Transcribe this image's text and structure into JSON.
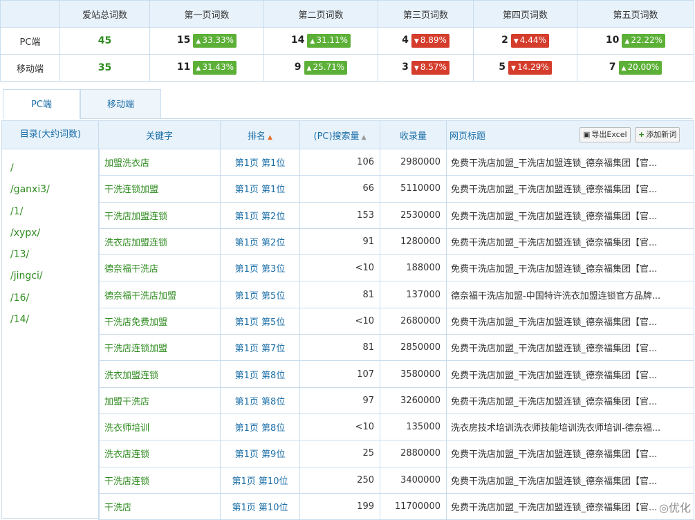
{
  "summary": {
    "headers": [
      "",
      "爱站总词数",
      "第一页词数",
      "第二页词数",
      "第三页词数",
      "第四页词数",
      "第五页词数"
    ],
    "rows": [
      {
        "label": "PC端",
        "total": "45",
        "cells": [
          {
            "num": "15",
            "pct": "33.33%",
            "dir": "up"
          },
          {
            "num": "14",
            "pct": "31.11%",
            "dir": "up"
          },
          {
            "num": "4",
            "pct": "8.89%",
            "dir": "down"
          },
          {
            "num": "2",
            "pct": "4.44%",
            "dir": "down"
          },
          {
            "num": "10",
            "pct": "22.22%",
            "dir": "up"
          }
        ]
      },
      {
        "label": "移动端",
        "total": "35",
        "cells": [
          {
            "num": "11",
            "pct": "31.43%",
            "dir": "up"
          },
          {
            "num": "9",
            "pct": "25.71%",
            "dir": "up"
          },
          {
            "num": "3",
            "pct": "8.57%",
            "dir": "down"
          },
          {
            "num": "5",
            "pct": "14.29%",
            "dir": "down"
          },
          {
            "num": "7",
            "pct": "20.00%",
            "dir": "up"
          }
        ]
      }
    ]
  },
  "tabs": [
    "PC端",
    "移动端"
  ],
  "dir": {
    "header": "目录(大约词数)",
    "items": [
      "/",
      "/ganxi3/",
      "/1/",
      "/xypx/",
      "/13/",
      "/jingci/",
      "/16/",
      "/14/"
    ]
  },
  "table": {
    "headers": {
      "keyword": "关键字",
      "rank": "排名",
      "search": "(PC)搜索量",
      "index": "收录量",
      "title": "网页标题"
    },
    "export_label": "导出Excel",
    "add_label": "添加新词",
    "rows": [
      {
        "kw": "加盟洗衣店",
        "rank": "第1页 第1位",
        "search": "106",
        "index": "2980000",
        "title": "免费干洗店加盟_干洗店加盟连锁_德奈福集团【官..."
      },
      {
        "kw": "干洗连锁加盟",
        "rank": "第1页 第1位",
        "search": "66",
        "index": "5110000",
        "title": "免费干洗店加盟_干洗店加盟连锁_德奈福集团【官..."
      },
      {
        "kw": "干洗店加盟连锁",
        "rank": "第1页 第2位",
        "search": "153",
        "index": "2530000",
        "title": "免费干洗店加盟_干洗店加盟连锁_德奈福集团【官..."
      },
      {
        "kw": "洗衣店加盟连锁",
        "rank": "第1页 第2位",
        "search": "91",
        "index": "1280000",
        "title": "免费干洗店加盟_干洗店加盟连锁_德奈福集团【官..."
      },
      {
        "kw": "德奈福干洗店",
        "rank": "第1页 第3位",
        "search": "<10",
        "index": "188000",
        "title": "免费干洗店加盟_干洗店加盟连锁_德奈福集团【官..."
      },
      {
        "kw": "德奈福干洗店加盟",
        "rank": "第1页 第5位",
        "search": "81",
        "index": "137000",
        "title": "德奈福干洗店加盟-中国特许洗衣加盟连锁官方品牌..."
      },
      {
        "kw": "干洗店免费加盟",
        "rank": "第1页 第5位",
        "search": "<10",
        "index": "2680000",
        "title": "免费干洗店加盟_干洗店加盟连锁_德奈福集团【官..."
      },
      {
        "kw": "干洗店连锁加盟",
        "rank": "第1页 第7位",
        "search": "81",
        "index": "2850000",
        "title": "免费干洗店加盟_干洗店加盟连锁_德奈福集团【官..."
      },
      {
        "kw": "洗衣加盟连锁",
        "rank": "第1页 第8位",
        "search": "107",
        "index": "3580000",
        "title": "免费干洗店加盟_干洗店加盟连锁_德奈福集团【官..."
      },
      {
        "kw": "加盟干洗店",
        "rank": "第1页 第8位",
        "search": "97",
        "index": "3260000",
        "title": "免费干洗店加盟_干洗店加盟连锁_德奈福集团【官..."
      },
      {
        "kw": "洗衣师培训",
        "rank": "第1页 第8位",
        "search": "<10",
        "index": "135000",
        "title": "洗衣房技术培训洗衣师技能培训洗衣师培训-德奈福..."
      },
      {
        "kw": "洗衣店连锁",
        "rank": "第1页 第9位",
        "search": "25",
        "index": "2880000",
        "title": "免费干洗店加盟_干洗店加盟连锁_德奈福集团【官..."
      },
      {
        "kw": "干洗店连锁",
        "rank": "第1页 第10位",
        "search": "250",
        "index": "3400000",
        "title": "免费干洗店加盟_干洗店加盟连锁_德奈福集团【官..."
      },
      {
        "kw": "干洗店",
        "rank": "第1页 第10位",
        "search": "199",
        "index": "11700000",
        "title": "免费干洗店加盟_干洗店加盟连锁_德奈福集团【官..."
      }
    ]
  },
  "watermark": "优化"
}
